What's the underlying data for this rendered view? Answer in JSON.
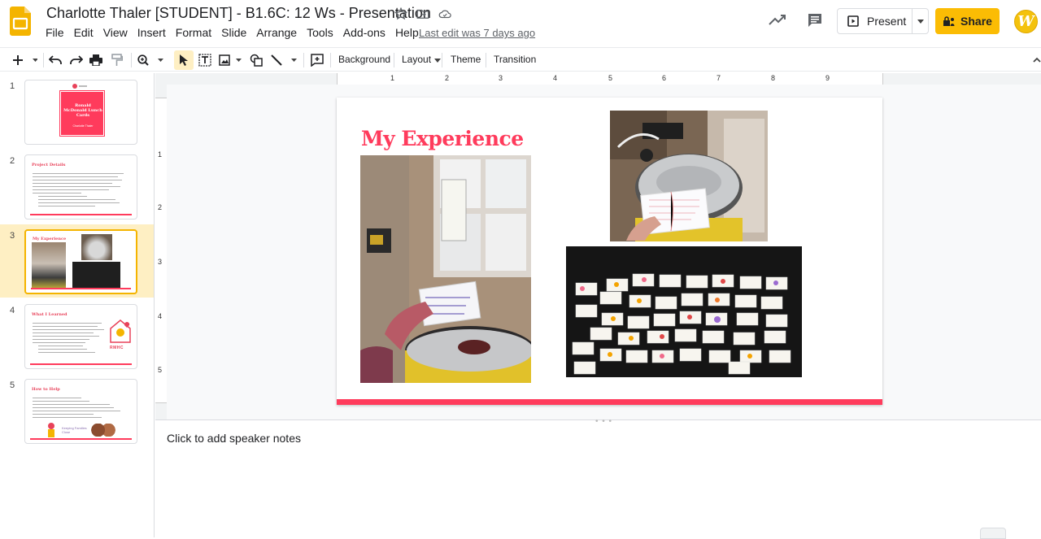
{
  "app": {
    "title": "Charlotte Thaler [STUDENT] - B1.6C: 12 Ws - Presentation",
    "last_edit": "Last edit was 7 days ago",
    "menu": [
      "File",
      "Edit",
      "View",
      "Insert",
      "Format",
      "Slide",
      "Arrange",
      "Tools",
      "Add-ons",
      "Help"
    ],
    "present_label": "Present",
    "share_label": "Share",
    "avatar_letter": "W",
    "brand_color": "#fbbc04",
    "accent_color": "#ff3b5c"
  },
  "toolbar": {
    "background_label": "Background",
    "layout_label": "Layout",
    "theme_label": "Theme",
    "transition_label": "Transition",
    "icons": [
      "new-slide-icon",
      "undo-icon",
      "redo-icon",
      "print-icon",
      "paint-format-icon",
      "zoom-icon",
      "select-icon",
      "text-box-icon",
      "image-icon",
      "shape-icon",
      "line-icon",
      "comment-add-icon"
    ]
  },
  "ruler": {
    "h_numbers": [
      "1",
      "2",
      "3",
      "4",
      "5",
      "6",
      "7",
      "8",
      "9"
    ],
    "v_numbers": [
      "1",
      "2",
      "3",
      "4",
      "5"
    ]
  },
  "filmstrip": {
    "slides": [
      {
        "num": "1",
        "title": "Ronald McDonald Lunch Cards",
        "subtitle": "Charlotte Thaler"
      },
      {
        "num": "2",
        "title": "Project Details"
      },
      {
        "num": "3",
        "title": "My Experience"
      },
      {
        "num": "4",
        "title": "What I Learned",
        "logo_text": "RMHC"
      },
      {
        "num": "5",
        "title": "How to Help",
        "footer_text": "Keeping Families Close"
      }
    ]
  },
  "slide": {
    "title": "My Experience",
    "photos": [
      "donation-box-photo",
      "donation-can-photo",
      "lunch-cards-board-photo"
    ]
  },
  "notes": {
    "placeholder": "Click to add speaker notes"
  }
}
